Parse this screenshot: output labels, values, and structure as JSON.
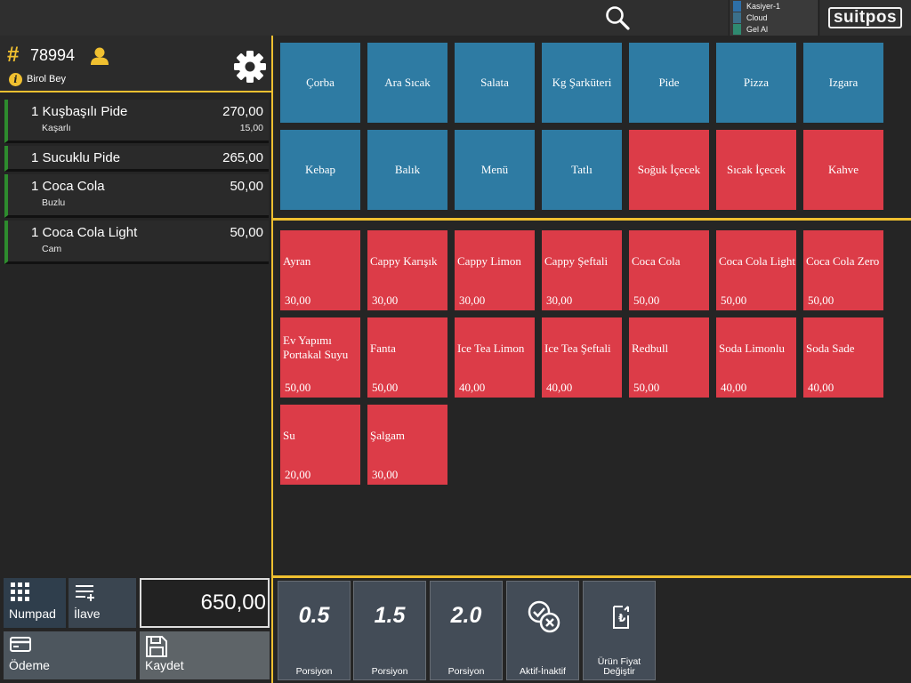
{
  "status": {
    "lines": [
      {
        "label": "Kasiyer-1",
        "color": "#2e6fa8"
      },
      {
        "label": "Cloud",
        "color": "#3b6f8a"
      },
      {
        "label": "Gel Al",
        "color": "#2f8a70"
      }
    ]
  },
  "brand": {
    "logo": "suitpos"
  },
  "order": {
    "hash": "#",
    "number": "78994",
    "customer": "Birol Bey",
    "info_icon": "i",
    "items": [
      {
        "qty": "1",
        "name": "Kuşbaşılı Pide",
        "price": "270,00",
        "mod": "Kaşarlı",
        "mod_price": "15,00"
      },
      {
        "qty": "1",
        "name": "Sucuklu Pide",
        "price": "265,00",
        "mod": "",
        "mod_price": ""
      },
      {
        "qty": "1",
        "name": "Coca Cola",
        "price": "50,00",
        "mod": "Buzlu",
        "mod_price": ""
      },
      {
        "qty": "1",
        "name": "Coca Cola Light",
        "price": "50,00",
        "mod": "Cam",
        "mod_price": ""
      }
    ],
    "total": "650,00"
  },
  "actions": {
    "numpad": "Numpad",
    "ilave": "İlave",
    "odeme": "Ödeme",
    "kaydet": "Kaydet"
  },
  "categories": [
    {
      "label": "Çorba",
      "color": "blue"
    },
    {
      "label": "Ara Sıcak",
      "color": "blue"
    },
    {
      "label": "Salata",
      "color": "blue"
    },
    {
      "label": "Kg Şarküteri",
      "color": "blue"
    },
    {
      "label": "Pide",
      "color": "blue"
    },
    {
      "label": "Pizza",
      "color": "blue"
    },
    {
      "label": "Izgara",
      "color": "blue"
    },
    {
      "label": "Kebap",
      "color": "blue"
    },
    {
      "label": "Balık",
      "color": "blue"
    },
    {
      "label": "Menü",
      "color": "blue"
    },
    {
      "label": "Tatlı",
      "color": "blue"
    },
    {
      "label": "Soğuk İçecek",
      "color": "red"
    },
    {
      "label": "Sıcak İçecek",
      "color": "red"
    },
    {
      "label": "Kahve",
      "color": "red"
    }
  ],
  "products": [
    {
      "name": "Ayran",
      "price": "30,00"
    },
    {
      "name": "Cappy Karışık",
      "price": "30,00"
    },
    {
      "name": "Cappy Limon",
      "price": "30,00"
    },
    {
      "name": "Cappy Şeftali",
      "price": "30,00"
    },
    {
      "name": "Coca Cola",
      "price": "50,00"
    },
    {
      "name": "Coca Cola Light",
      "price": "50,00"
    },
    {
      "name": "Coca Cola Zero",
      "price": "50,00"
    },
    {
      "name": "Ev Yapımı Portakal Suyu",
      "price": "50,00"
    },
    {
      "name": "Fanta",
      "price": "50,00"
    },
    {
      "name": "Ice Tea Limon",
      "price": "40,00"
    },
    {
      "name": "Ice Tea Şeftali",
      "price": "40,00"
    },
    {
      "name": "Redbull",
      "price": "50,00"
    },
    {
      "name": "Soda Limonlu",
      "price": "40,00"
    },
    {
      "name": "Soda Sade",
      "price": "40,00"
    },
    {
      "name": "Su",
      "price": "20,00"
    },
    {
      "name": "Şalgam",
      "price": "30,00"
    }
  ],
  "portions": [
    {
      "value": "0.5",
      "label": "Porsiyon"
    },
    {
      "value": "1.5",
      "label": "Porsiyon"
    },
    {
      "value": "2.0",
      "label": "Porsiyon"
    }
  ],
  "tools": [
    {
      "label": "Aktif-İnaktif",
      "icon": "toggle-active-icon"
    },
    {
      "label": "Ürün Fiyat Değiştir",
      "icon": "price-change-icon"
    }
  ],
  "colors": {
    "accent": "#f0c030",
    "category_blue": "#2e7ba3",
    "category_red": "#dc3c48",
    "item_bar": "#2e8b2e"
  }
}
